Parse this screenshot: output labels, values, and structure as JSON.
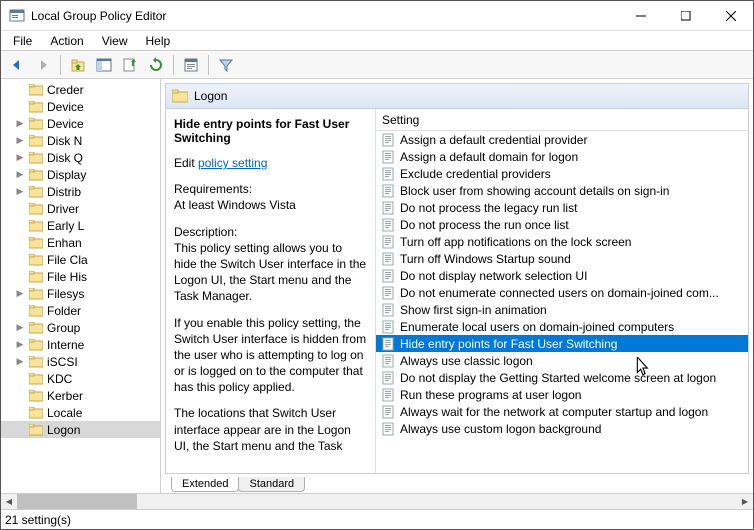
{
  "window": {
    "title": "Local Group Policy Editor"
  },
  "menu": {
    "file": "File",
    "action": "Action",
    "view": "View",
    "help": "Help"
  },
  "header": {
    "label": "Logon"
  },
  "desc": {
    "title": "Hide entry points for Fast User Switching",
    "edit_prefix": "Edit ",
    "edit_link": "policy setting",
    "req_label": "Requirements:",
    "req_value": "At least Windows Vista",
    "desc_label": "Description:",
    "desc_p1": "This policy setting allows you to hide the Switch User interface in the Logon UI, the Start menu and the Task Manager.",
    "desc_p2": "If you enable this policy setting, the Switch User interface is hidden from the user who is attempting to log on or is logged on to the computer that has this policy applied.",
    "desc_p3": "The locations that Switch User interface appear are in the Logon UI, the Start menu and the Task"
  },
  "listHeader": "Setting",
  "tree": [
    {
      "label": "Creder",
      "chev": false
    },
    {
      "label": "Device",
      "chev": false
    },
    {
      "label": "Device",
      "chev": true
    },
    {
      "label": "Disk N",
      "chev": true
    },
    {
      "label": "Disk Q",
      "chev": true
    },
    {
      "label": "Display",
      "chev": true
    },
    {
      "label": "Distrib",
      "chev": true
    },
    {
      "label": "Driver",
      "chev": false
    },
    {
      "label": "Early L",
      "chev": false
    },
    {
      "label": "Enhan",
      "chev": false
    },
    {
      "label": "File Cla",
      "chev": false
    },
    {
      "label": "File His",
      "chev": false
    },
    {
      "label": "Filesys",
      "chev": true
    },
    {
      "label": "Folder",
      "chev": false
    },
    {
      "label": "Group",
      "chev": true
    },
    {
      "label": "Interne",
      "chev": true
    },
    {
      "label": "iSCSI",
      "chev": true
    },
    {
      "label": "KDC",
      "chev": false
    },
    {
      "label": "Kerber",
      "chev": false
    },
    {
      "label": "Locale",
      "chev": false
    },
    {
      "label": "Logon",
      "chev": false,
      "selected": true
    }
  ],
  "settings": [
    "Assign a default credential provider",
    "Assign a default domain for logon",
    "Exclude credential providers",
    "Block user from showing account details on sign-in",
    "Do not process the legacy run list",
    "Do not process the run once list",
    "Turn off app notifications on the lock screen",
    "Turn off Windows Startup sound",
    "Do not display network selection UI",
    "Do not enumerate connected users on domain-joined com...",
    "Show first sign-in animation",
    "Enumerate local users on domain-joined computers",
    "Hide entry points for Fast User Switching",
    "Always use classic logon",
    "Do not display the Getting Started welcome screen at logon",
    "Run these programs at user logon",
    "Always wait for the network at computer startup and logon",
    "Always use custom logon background"
  ],
  "selectedSetting": 12,
  "tabs": {
    "extended": "Extended",
    "standard": "Standard"
  },
  "status": "21 setting(s)"
}
